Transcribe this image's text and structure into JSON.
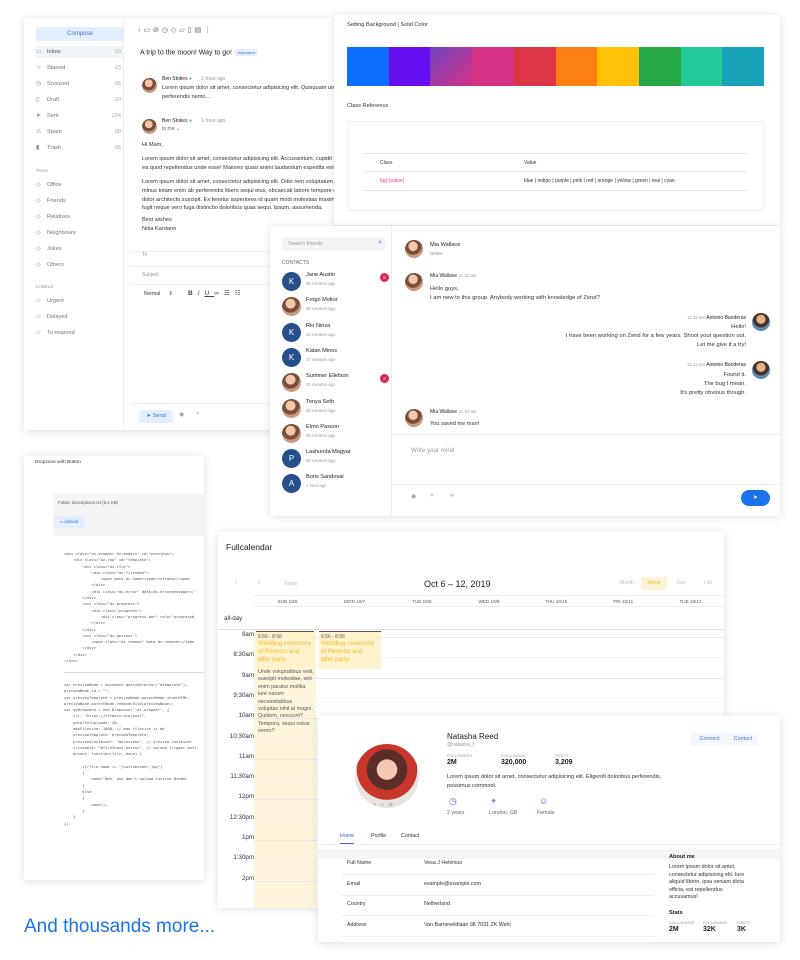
{
  "mail": {
    "compose_label": "Compose",
    "folders": [
      {
        "icon": "inbox-icon",
        "label": "Inbox",
        "count": "03"
      },
      {
        "icon": "star-icon",
        "label": "Starred",
        "count": "23"
      },
      {
        "icon": "clock-icon",
        "label": "Snoozed",
        "count": "05"
      },
      {
        "icon": "file-icon",
        "label": "Draft",
        "count": "20"
      },
      {
        "icon": "send-icon",
        "label": "Sent",
        "count": "124"
      },
      {
        "icon": "alert-icon",
        "label": "Spam",
        "count": "00"
      },
      {
        "icon": "trash-icon",
        "label": "Trash",
        "count": "05"
      }
    ],
    "tags_heading": "TAGS",
    "tags": [
      "Office",
      "Friends",
      "Relatives",
      "Neighbours",
      "Jokes",
      "Others"
    ],
    "labels_heading": "LABELS",
    "labels": [
      "Urgent",
      "Delayed",
      "To respond"
    ],
    "subject": "A trip to the moon! Way to go!",
    "important_badge": "Important",
    "msg1_sender": "Ben Stokes",
    "msg1_time": "1 hour ago",
    "msg1_preview_1": "Lorem ipsum dolor sit amet, consectetur adipisicing elit. Quisquam un",
    "msg1_preview_2": "perferendis nemo...",
    "msg2_sender": "Ben Stokes",
    "msg2_to": "to me",
    "msg2_time": "1 hour ago",
    "greeting": "Hi Mam,",
    "para1": [
      "Lorem ipsum dolor sit amet, consectetur adipisicing elit. Accusantium, cupidit",
      "ea quod repellendus unde esse! Maiores quasi animi laudantium expedita enir"
    ],
    "para2": [
      "Lorem ipsum dolor sit amet, consectetur adipisicing elit. Odio rem voluptatum",
      "minus totam enim ab perferendis libero sequi eius, obcaecati labore tempore c",
      "dolor architecto suscipit. Ex fenetur asperiores id quam modi molestias maxime, pe",
      "fugit neque vero fuga distinctio doloribus quas sequi. Ipsum, assumenda."
    ],
    "signoff": [
      "Best wishes",
      "Nola Kardano"
    ],
    "to_label": "To",
    "subject_label": "Subject",
    "format_select": "Normal",
    "send_label": "Send"
  },
  "colors": {
    "title": "Setting Background | Solid Color",
    "swatches": [
      "#0d6efd",
      "#6610f2",
      "#6f42c1",
      "#d63384",
      "#dc3545",
      "#fd7e14",
      "#ffc107",
      "#28a745",
      "#20c997",
      "#17a2b8"
    ],
    "class_ref_title": "Class Reference",
    "col_class": "Class",
    "col_value": "Value",
    "row_class": "bg{-{value}",
    "row_value": "blue | indigo | purple | pink | red | orange | yellow | green | teal | cyan"
  },
  "chat": {
    "search_placeholder": "Search friends",
    "contacts_heading": "CONTACTS",
    "friends": [
      {
        "name": "Jane Austin",
        "time": "05 minutes ago",
        "initial": "K",
        "badge": "5"
      },
      {
        "name": "Frogo Meltor",
        "time": "09 minutes ago",
        "initial": "",
        "badge": ""
      },
      {
        "name": "Rio Ninsa",
        "time": "12 minutes ago",
        "initial": "K",
        "badge": ""
      },
      {
        "name": "Katan Minos",
        "time": "17 minutes ago",
        "initial": "K",
        "badge": ""
      },
      {
        "name": "Summer Ellefson",
        "time": "20 minutes ago",
        "initial": "",
        "badge": "3"
      },
      {
        "name": "Tonya Seth",
        "time": "34 minutes ago",
        "initial": "",
        "badge": ""
      },
      {
        "name": "Elmo Paxson",
        "time": "40 minutes ago",
        "initial": "",
        "badge": ""
      },
      {
        "name": "Lashunda Magyar",
        "time": "50 minutes ago",
        "initial": "P",
        "badge": ""
      },
      {
        "name": "Boris Sandoval",
        "time": "1 hour ago",
        "initial": "A",
        "badge": ""
      }
    ],
    "header_name": "Mia Wallace",
    "header_status": "Online",
    "m1_name": "Mia Wallace",
    "m1_time": "11:32 am",
    "m1_lines": [
      "Hello guys,",
      "I am new to this group. Anybody working with knowledge of Zend?"
    ],
    "m2_time": "11:33 am",
    "m2_name": "Antonio Banderas",
    "m2_lines": [
      "Hello!",
      "I have been working on Zend for a few years. Shoot yout question out.",
      "Let me give it a try!"
    ],
    "m3_time": "11:33 am",
    "m3_name": "Antonio Banderas",
    "m3_lines": [
      "Found it.",
      "The bug I mean.",
      "It's pretty obvious though."
    ],
    "m4_name": "Mia Wallace",
    "m4_time": "11:34 am",
    "m4_text": "You saved me man!",
    "composer_placeholder": "Write your mind"
  },
  "dropzone": {
    "title": "Dropzone with Button",
    "file": "Folder descriptions.txt (6.2 KB)",
    "upload_label": "Upload",
    "code_html": [
      "<div class=\"dz-wrapper dz-modern\" id=\"previews\">",
      "    <div class=\"dz-row\" id=\"template\">",
      "        <div class=\"dz-file\">",
      "            <div class=\"dz-filename\">",
      "                <span data-dz-name><span><strong>(<span",
      "            </div>",
      "            <div class=\"dz-error\" data-dz-errormessage></",
      "        </div>",
      "        <div class=\"dz-progress\">",
      "            <div class=\"progress\">",
      "                <div class=\"progress-bar\" role=\"progressb",
      "            </div>",
      "        </div>",
      "        <div class=\"dz-options\">",
      "            <span class=\"dz-remove\" data-dz-remove></span",
      "        </div>",
      "    </div>",
      "</div>"
    ],
    "code_js": [
      "var previewNode = document.querySelector(\"#template\");",
      "previewNode.id = \"\";",
      "var previewTemplate = previewNode.parentNode.innerHTML;",
      "previewNode.parentNode.removeChild(previewNode);",
      "",
      "var myDropzone = new Dropzone(\".dz-wrapper\", {",
      "    url: \"https://httpbin.org/post\",",
      "    parallelUploads: 20,",
      "    maxFilesize: 1000, // max filesize is mb",
      "    previewTemplate: previewTemplate,",
      "    previewsContainer: \"#previews\", // preview container ",
      "    clickable: \"#fileInput-button\", // upload trigger butt",
      "    accept: function(file, done) {",
      "        ",
      "        if(file.name == \"justinbieber.jpg\")",
      "        {",
      "            done(\"Nah, you don't upload Justine Bieber",
      "        }",
      "        else",
      "        {",
      "            done();",
      "        }",
      "    }",
      "});"
    ]
  },
  "calendar": {
    "title": "Fullcalendar",
    "today_label": "Today",
    "range": "Oct 6 – 12, 2019",
    "views": [
      "Month",
      "Week",
      "Day",
      "List"
    ],
    "days": [
      "SUN 10/6",
      "MON 10/7",
      "TUE 10/8",
      "WED 10/9",
      "THU 10/10",
      "FRI 10/11",
      "TUE 10/12"
    ],
    "allday_label": "all-day",
    "times": [
      "8am",
      "8:30am",
      "9am",
      "9:30am",
      "10am",
      "10:30am",
      "11am",
      "11:30am",
      "12pm",
      "12:30pm",
      "1pm",
      "1:30pm",
      "2pm"
    ],
    "event_time": "6:56 - 8:56",
    "event_title": [
      "Wedding ceremony",
      "of Reshizu and",
      "after party"
    ],
    "event_desc": [
      "Unde voluptatibus velit,",
      "suscipit molestiae, sint",
      "enim paratur molitia",
      "iure narum",
      "necessitatibus",
      "voluptas nihil at magni.",
      "Quidem, nesciunt?",
      "Tempora, sequi natus",
      "nemo?"
    ]
  },
  "profile": {
    "name": "Natasha Reed",
    "handle": "@natasha_r",
    "connect_label": "Connect",
    "contact_label": "Contact",
    "stats": [
      {
        "label": "FOLLOWERS",
        "value": "2M"
      },
      {
        "label": "FOLLOWING",
        "value": "320,000"
      },
      {
        "label": "POSTS",
        "value": "3,209"
      }
    ],
    "bio": [
      "Lorem ipsum dolor sit amet, consectetur adipisicing elit. Eligendi dolonbus perferendis,",
      "possimus commodi."
    ],
    "meta": [
      {
        "icon": "clock-icon",
        "text": "2 years"
      },
      {
        "icon": "map-pin-icon",
        "text": "London, GB"
      },
      {
        "icon": "user-icon",
        "text": "Female"
      }
    ],
    "tabs": [
      "Home",
      "Profile",
      "Contact"
    ],
    "fields": [
      {
        "label": "Full Name",
        "value": "Vesa J Helenius"
      },
      {
        "label": "Email",
        "value": "example@example.com"
      },
      {
        "label": "Country",
        "value": "Netherland"
      },
      {
        "label": "Address",
        "value": "Van Barneveldlaan 98 7031 ZK Wehl"
      }
    ],
    "about_title": "About me",
    "about_text": [
      "Lorem ipsum dolor sit amet,",
      "consectetur adipisicing elit. Iure",
      "aliquid libero, ipsa veniam dicta",
      "officia, est repellendus",
      "accusamus!"
    ],
    "stats_title": "Stats",
    "stats2": [
      {
        "label": "FOLLOWERS",
        "value": "2M"
      },
      {
        "label": "FOLLOWING",
        "value": "32K"
      },
      {
        "label": "POSTS",
        "value": "3K"
      }
    ]
  },
  "tagline": "And thousands more..."
}
